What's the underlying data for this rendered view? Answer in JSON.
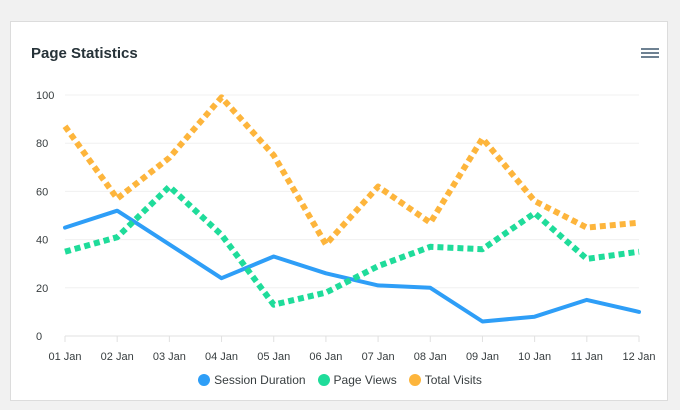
{
  "header": {
    "title": "Page Statistics",
    "menu_icon": "hamburger-menu-icon"
  },
  "chart_data": {
    "type": "line",
    "title": "Page Statistics",
    "categories": [
      "01 Jan",
      "02 Jan",
      "03 Jan",
      "04 Jan",
      "05 Jan",
      "06 Jan",
      "07 Jan",
      "08 Jan",
      "09 Jan",
      "10 Jan",
      "11 Jan",
      "12 Jan"
    ],
    "y_ticks": [
      "0",
      "20",
      "40",
      "60",
      "80",
      "100"
    ],
    "ylim": [
      0,
      100
    ],
    "grid": true,
    "legend_position": "bottom",
    "series": [
      {
        "name": "Session Duration",
        "color": "#2e9ef7",
        "style": "solid",
        "values": [
          45,
          52,
          38,
          24,
          33,
          26,
          21,
          20,
          6,
          8,
          15,
          10
        ]
      },
      {
        "name": "Page Views",
        "color": "#1fdc9a",
        "style": "dotted",
        "values": [
          35,
          41,
          62,
          42,
          13,
          18,
          29,
          37,
          36,
          51,
          32,
          35
        ]
      },
      {
        "name": "Total Visits",
        "color": "#fdb53c",
        "style": "dotted",
        "values": [
          87,
          57,
          74,
          99,
          75,
          38,
          62,
          47,
          82,
          56,
          45,
          47
        ]
      }
    ]
  }
}
